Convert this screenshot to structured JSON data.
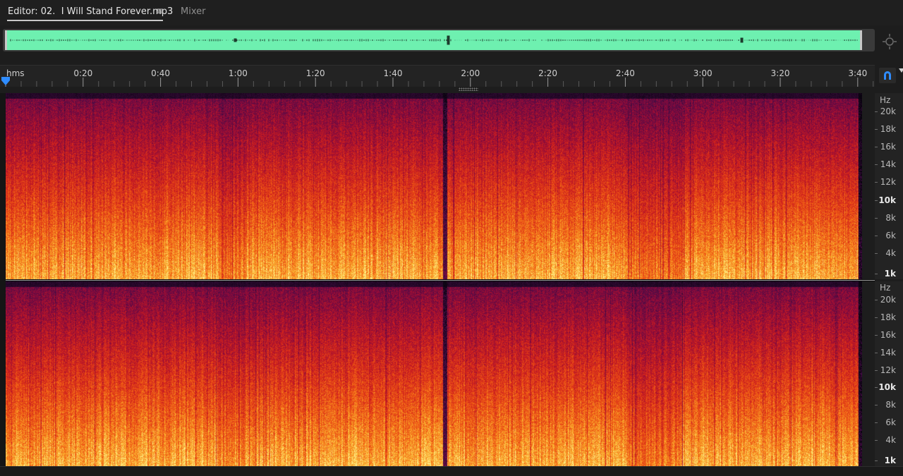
{
  "tabs": {
    "editor_label": "Editor: 02.  I Will Stand Forever.mp3",
    "menu_icon": "≡",
    "mixer_label": "Mixer"
  },
  "overview": {
    "waveform_color": "#6ef0b0",
    "background_color": "#3a3a3a"
  },
  "ruler": {
    "unit": "hms",
    "ticks": [
      {
        "label": "0:20",
        "seconds": 20
      },
      {
        "label": "0:40",
        "seconds": 40
      },
      {
        "label": "1:00",
        "seconds": 60
      },
      {
        "label": "1:20",
        "seconds": 80
      },
      {
        "label": "1:40",
        "seconds": 100
      },
      {
        "label": "2:00",
        "seconds": 120
      },
      {
        "label": "2:20",
        "seconds": 140
      },
      {
        "label": "2:40",
        "seconds": 160
      },
      {
        "label": "3:00",
        "seconds": 180
      },
      {
        "label": "3:20",
        "seconds": 200
      },
      {
        "label": "3:40",
        "seconds": 220
      }
    ],
    "playhead_color": "#2f8cff",
    "playhead_seconds": 0
  },
  "frequency_scale": {
    "unit": "Hz",
    "labels": [
      "20k",
      "18k",
      "16k",
      "14k",
      "12k",
      "10k",
      "8k",
      "6k",
      "4k",
      "1k"
    ],
    "bold_labels": [
      "10k",
      "1k"
    ]
  },
  "channels": [
    "top",
    "bottom"
  ],
  "icons": {
    "zoom": "zoom-icon",
    "snap": "snapping-magnet-icon",
    "playhead": "playhead-marker-icon",
    "menu": "hamburger-menu-icon",
    "context": "context-menu-triangle-icon"
  }
}
